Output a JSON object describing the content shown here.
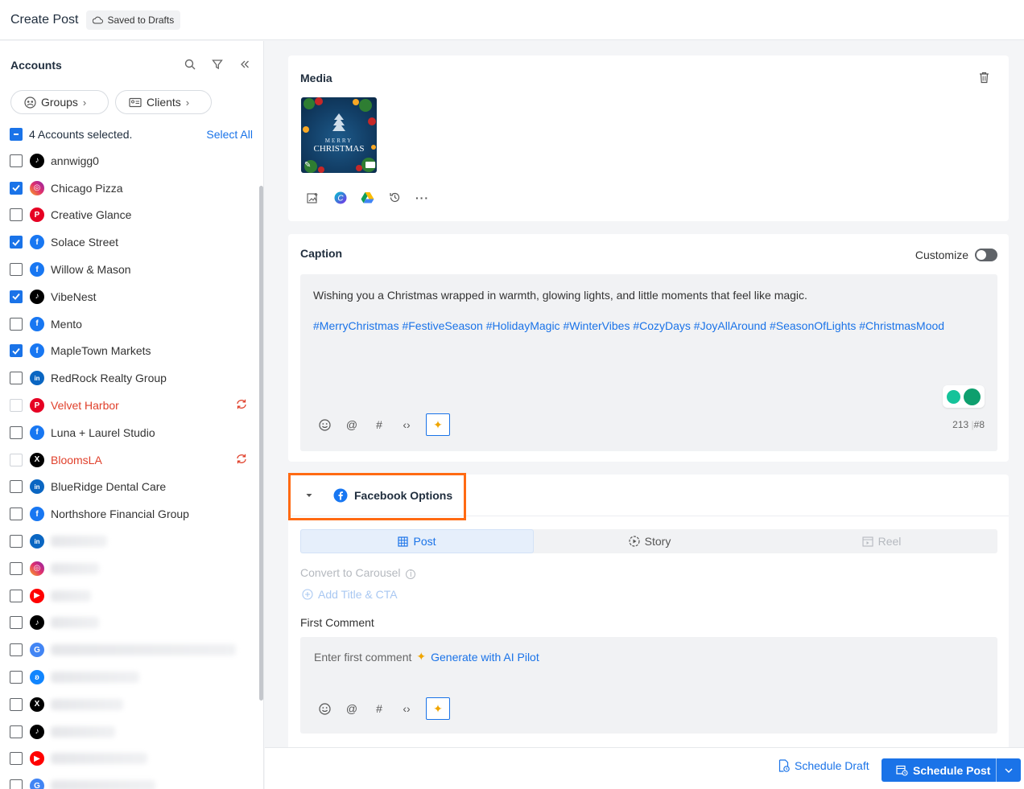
{
  "header": {
    "title": "Create Post",
    "status": "Saved to Drafts"
  },
  "sidebar": {
    "heading": "Accounts",
    "groups_label": "Groups",
    "clients_label": "Clients",
    "selected_text": "4 Accounts selected.",
    "select_all": "Select All",
    "accounts": [
      {
        "name": "annwigg0",
        "platform": "tiktok",
        "checked": false
      },
      {
        "name": "Chicago Pizza",
        "platform": "instagram",
        "checked": true
      },
      {
        "name": "Creative Glance",
        "platform": "pinterest",
        "checked": false
      },
      {
        "name": "Solace Street",
        "platform": "facebook",
        "checked": true
      },
      {
        "name": "Willow & Mason",
        "platform": "facebook",
        "checked": false
      },
      {
        "name": "VibeNest",
        "platform": "tiktok",
        "checked": true
      },
      {
        "name": "Mento",
        "platform": "facebook",
        "checked": false
      },
      {
        "name": "MapleTown Markets",
        "platform": "facebook",
        "checked": true
      },
      {
        "name": "RedRock Realty Group",
        "platform": "linkedin",
        "checked": false
      },
      {
        "name": "Velvet Harbor",
        "platform": "pinterest",
        "checked": false,
        "error": true
      },
      {
        "name": "Luna + Laurel Studio",
        "platform": "facebook",
        "checked": false
      },
      {
        "name": "BloomsLA",
        "platform": "x",
        "checked": false,
        "error": true
      },
      {
        "name": "BlueRidge Dental Care",
        "platform": "linkedin",
        "checked": false
      },
      {
        "name": "Northshore Financial Group",
        "platform": "facebook",
        "checked": false
      }
    ],
    "blurred_platforms": [
      "linkedin",
      "instagram",
      "youtube",
      "tiktok",
      "google",
      "bluesky",
      "x",
      "tiktok",
      "youtube",
      "google"
    ]
  },
  "media": {
    "title": "Media",
    "thumb_line1": "MERRY",
    "thumb_line2": "CHRISTMAS",
    "tools": [
      "image-edit-icon",
      "canva-icon",
      "google-drive-icon",
      "history-icon",
      "more-icon"
    ]
  },
  "caption": {
    "title": "Caption",
    "customize_label": "Customize",
    "text": "Wishing you a Christmas wrapped in warmth, glowing lights, and little moments that feel like magic.",
    "hashtags": "#MerryChristmas #FestiveSeason #HolidayMagic #WinterVibes #CozyDays #JoyAllAround #SeasonOfLights #ChristmasMood",
    "char_count": "213",
    "hashtag_count": "#8"
  },
  "facebook_options": {
    "title": "Facebook Options",
    "tabs": [
      "Post",
      "Story",
      "Reel"
    ],
    "convert_carousel": "Convert to Carousel",
    "add_title_cta": "Add Title & CTA",
    "first_comment_label": "First Comment",
    "first_comment_placeholder": "Enter first comment",
    "generate_ai": "Generate with AI Pilot"
  },
  "footer": {
    "schedule_draft": "Schedule Draft",
    "schedule_post": "Schedule Post"
  },
  "colors": {
    "accent": "#1a73e8",
    "highlight": "#ff6a13",
    "error": "#e0402b"
  }
}
